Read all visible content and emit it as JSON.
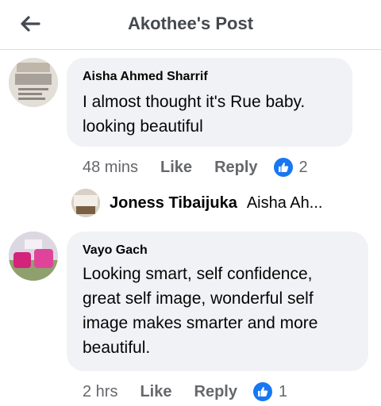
{
  "header": {
    "title": "Akothee's Post"
  },
  "comments": [
    {
      "author": "Aisha Ahmed Sharrif",
      "text_line1": "I almost thought it's Rue baby.",
      "text_line2": "looking beautiful",
      "time": "48 mins",
      "like_label": "Like",
      "reply_label": "Reply",
      "reaction_count": "2"
    },
    {
      "author": "Vayo Gach",
      "text_line1": "Looking smart, self confidence,",
      "text_line2": "great self image, wonderful self",
      "text_line3": "image makes smarter and more",
      "text_line4": "beautiful.",
      "time": "2 hrs",
      "like_label": "Like",
      "reply_label": "Reply",
      "reaction_count": "1"
    }
  ],
  "reply_preview": {
    "author": "Joness Tibaijuka",
    "snippet": "Aisha Ah..."
  },
  "colors": {
    "accent": "#1877f2",
    "bubble": "#f0f2f5",
    "muted_text": "#65676b"
  }
}
